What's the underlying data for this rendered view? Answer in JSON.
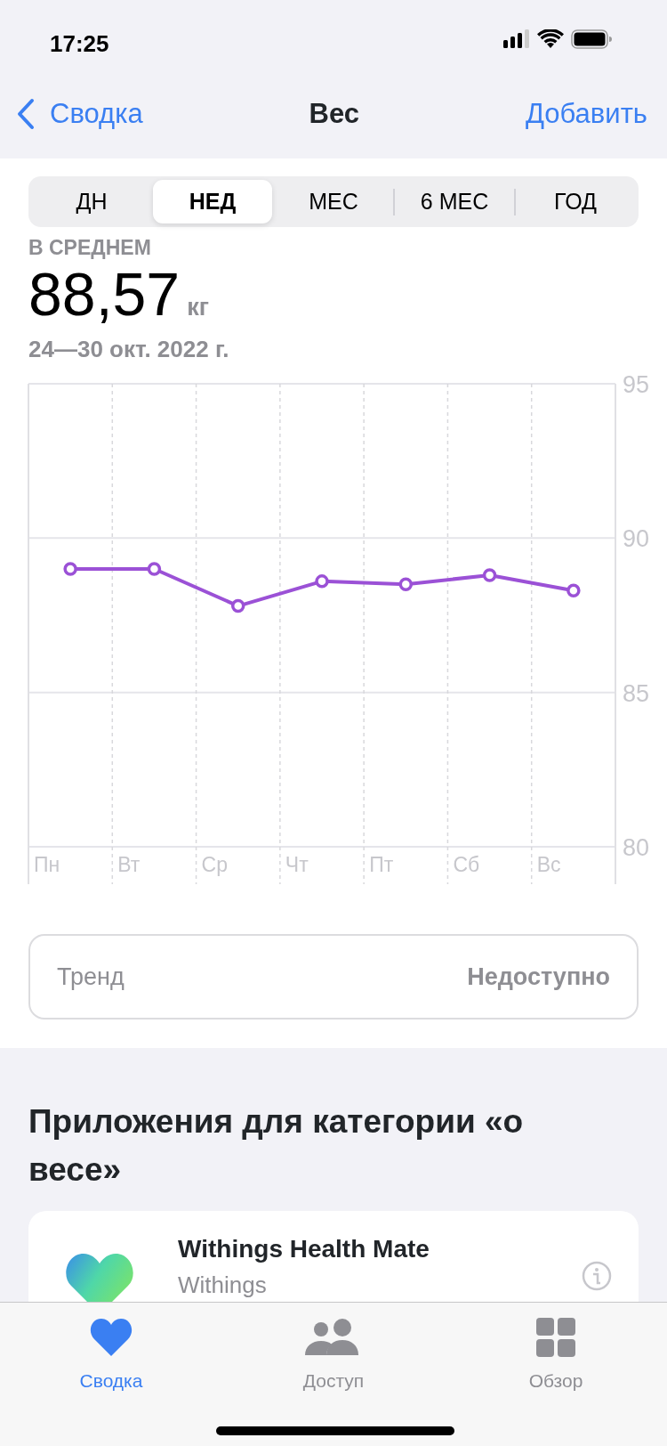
{
  "status_bar": {
    "time": "17:25"
  },
  "nav": {
    "back_label": "Сводка",
    "title": "Вес",
    "action": "Добавить"
  },
  "segments": [
    {
      "label": "ДН",
      "selected": false
    },
    {
      "label": "НЕД",
      "selected": true
    },
    {
      "label": "МЕС",
      "selected": false
    },
    {
      "label": "6 МЕС",
      "selected": false
    },
    {
      "label": "ГОД",
      "selected": false
    }
  ],
  "summary": {
    "label": "В СРЕДНЕМ",
    "value": "88,57",
    "unit": "кг",
    "range": "24—30 окт. 2022 г."
  },
  "chart_data": {
    "type": "line",
    "categories": [
      "Пн",
      "Вт",
      "Ср",
      "Чт",
      "Пт",
      "Сб",
      "Вс"
    ],
    "series": [
      {
        "color": "#9b51d6",
        "marker": "circle",
        "values": [
          89.0,
          89.0,
          87.8,
          88.6,
          88.5,
          88.8,
          88.3
        ]
      }
    ],
    "ylim": [
      80,
      95
    ],
    "yticks": [
      80,
      85,
      90,
      95
    ]
  },
  "trend": {
    "label": "Тренд",
    "value": "Недоступно"
  },
  "apps_section": {
    "title": "Приложения для категории «о весе»",
    "apps": [
      {
        "name": "Withings Health Mate",
        "developer": "Withings"
      }
    ]
  },
  "tab_bar": [
    {
      "label": "Сводка",
      "kind": "heart",
      "selected": true
    },
    {
      "label": "Доступ",
      "kind": "people",
      "selected": false
    },
    {
      "label": "Обзор",
      "kind": "grid",
      "selected": false
    }
  ]
}
